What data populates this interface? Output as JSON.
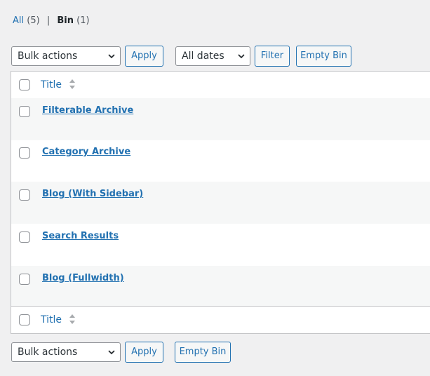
{
  "views": {
    "all_label": "All",
    "all_count": "(5)",
    "separator": "|",
    "bin_label": "Bin",
    "bin_count": "(1)"
  },
  "top_nav": {
    "bulk_actions": "Bulk actions",
    "apply_label": "Apply",
    "date_filter": "All dates",
    "filter_label": "Filter",
    "empty_bin_label": "Empty Bin"
  },
  "table": {
    "header_title": "Title",
    "footer_title": "Title",
    "rows": [
      {
        "title": "Filterable Archive"
      },
      {
        "title": "Category Archive"
      },
      {
        "title": "Blog (With Sidebar)"
      },
      {
        "title": "Search Results"
      },
      {
        "title": "Blog (Fullwidth)"
      }
    ]
  },
  "bottom_nav": {
    "bulk_actions": "Bulk actions",
    "apply_label": "Apply",
    "empty_bin_label": "Empty Bin"
  },
  "icons": {
    "select_arrow": "chevron-down-icon",
    "sort": "sort-arrows-icon"
  },
  "colors": {
    "link": "#2271b1",
    "background": "#f0f0f1",
    "border": "#c3c4c7",
    "row_alt": "#f6f7f7"
  }
}
